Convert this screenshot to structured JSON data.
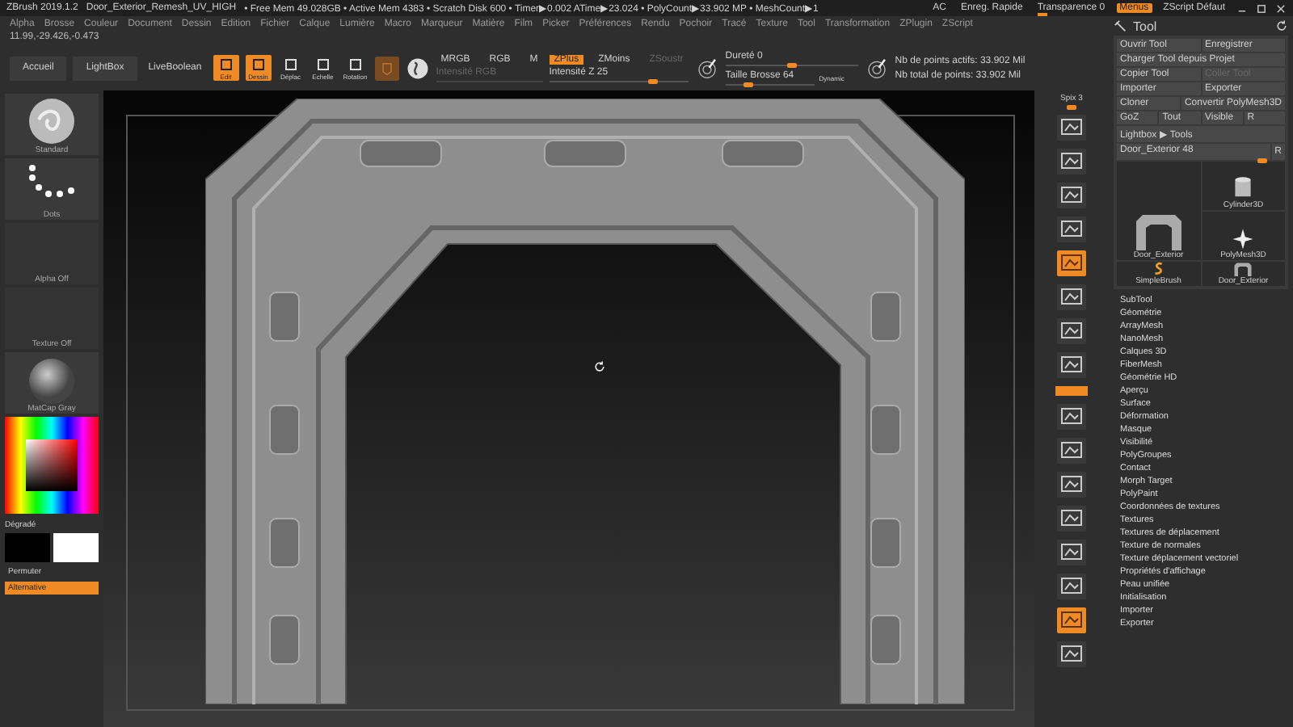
{
  "title_bar": {
    "app": "ZBrush 2019.1.2",
    "file": "Door_Exterior_Remesh_UV_HIGH",
    "stats": "• Free Mem 49.028GB • Active Mem 4383 • Scratch Disk 600 • Timer▶0.002 ATime▶23.024 • PolyCount▶33.902 MP • MeshCount▶1",
    "items": [
      {
        "label": "AC",
        "kind": "text"
      },
      {
        "label": "Enreg. Rapide",
        "kind": "text"
      },
      {
        "label": "Transparence 0",
        "kind": "slider",
        "level": 0.05
      },
      {
        "label": "Menus",
        "kind": "toggle",
        "selected": true
      },
      {
        "label": "ZScript Défaut",
        "kind": "text"
      }
    ]
  },
  "menu_bar": [
    "Alpha",
    "Brosse",
    "Couleur",
    "Document",
    "Dessin",
    "Edition",
    "Fichier",
    "Calque",
    "Lumière",
    "Macro",
    "Marqueur",
    "Matière",
    "Film",
    "Picker",
    "Préférences",
    "Rendu",
    "Pochoir",
    "Tracé",
    "Texture",
    "Tool",
    "Transformation",
    "ZPlugin",
    "ZScript"
  ],
  "coordinates": "11.99,-29.426,-0.473",
  "toolbar": {
    "nav_buttons": [
      "Accueil",
      "LightBox",
      "LiveBoolean"
    ],
    "modes": [
      {
        "label": "Edit",
        "selected": true
      },
      {
        "label": "Dessin",
        "selected": true
      },
      {
        "label": "Déplac",
        "selected": false
      },
      {
        "label": "Echelle",
        "selected": false
      },
      {
        "label": "Rotation",
        "selected": false
      }
    ],
    "rgb_modes": [
      {
        "label": "MRGB",
        "selected": false
      },
      {
        "label": "RGB",
        "selected": false
      },
      {
        "label": "M",
        "selected": false
      }
    ],
    "rgb_intensity": {
      "label": "Intensité RGB",
      "disabled": true
    },
    "z_modes": [
      {
        "label": "ZPlus",
        "selected": true,
        "disabled": false
      },
      {
        "label": "ZMoins",
        "selected": false,
        "disabled": false
      },
      {
        "label": "ZSoustr",
        "selected": false,
        "disabled": true
      }
    ],
    "z_intensity": {
      "label": "Intensité Z 25",
      "level": 0.75
    },
    "hardness": {
      "label": "Dureté 0",
      "level": 0.5
    },
    "brush_size": {
      "label": "Taille Brosse 64",
      "level": 0.25
    },
    "dynamic": "Dynamic",
    "active_points": "Nb de points actifs: 33.902 Mil",
    "total_points": "Nb total de points: 33.902 Mil"
  },
  "left_panel": {
    "brush": "Standard",
    "stroke": "Dots",
    "alpha": "Alpha Off",
    "texture": "Texture Off",
    "material": "MatCap Gray",
    "gradient": "Dégradé",
    "swap": "Permuter",
    "alternate": {
      "label": "Alternative",
      "selected": true
    }
  },
  "shelf": [
    {
      "kind": "slider",
      "label": "Spix 3",
      "level": 0.5
    },
    {
      "kind": "button",
      "selected": false
    },
    {
      "kind": "button",
      "selected": false
    },
    {
      "kind": "button",
      "selected": false
    },
    {
      "kind": "button",
      "selected": false
    },
    {
      "kind": "button",
      "selected": true
    },
    {
      "kind": "button",
      "selected": false
    },
    {
      "kind": "button",
      "selected": false
    },
    {
      "kind": "button",
      "selected": false
    },
    {
      "kind": "bar",
      "selected": true
    },
    {
      "kind": "button",
      "selected": false
    },
    {
      "kind": "button",
      "selected": false
    },
    {
      "kind": "button",
      "selected": false
    },
    {
      "kind": "button",
      "selected": false
    },
    {
      "kind": "button",
      "selected": false
    },
    {
      "kind": "button",
      "selected": false
    },
    {
      "kind": "button",
      "selected": true
    },
    {
      "kind": "button",
      "selected": false
    }
  ],
  "tool_panel": {
    "title": "Tool",
    "button_rows": [
      [
        {
          "label": "Ouvrir Tool",
          "disabled": false
        },
        {
          "label": "Enregistrer",
          "disabled": false
        }
      ],
      [
        {
          "label": "Charger Tool depuis Projet",
          "disabled": false
        }
      ],
      [
        {
          "label": "Copier Tool",
          "disabled": false
        },
        {
          "label": "Coller Tool",
          "disabled": true
        }
      ],
      [
        {
          "label": "Importer",
          "disabled": false
        },
        {
          "label": "Exporter",
          "disabled": false
        }
      ],
      [
        {
          "label": "Cloner",
          "disabled": false
        },
        {
          "label": "Convertir PolyMesh3D",
          "disabled": false
        }
      ],
      [
        {
          "label": "GoZ",
          "disabled": false
        },
        {
          "label": "Tout",
          "disabled": false
        },
        {
          "label": "Visible",
          "disabled": false
        },
        {
          "label": "R",
          "disabled": false
        }
      ],
      [
        {
          "label": "Lightbox ▶ Tools",
          "disabled": false
        }
      ]
    ],
    "tool_slider": {
      "label": "Door_Exterior 48",
      "level": 0.95,
      "reset": "R"
    },
    "tools": [
      {
        "label": "Cylinder3D",
        "kind": "cylinder"
      },
      {
        "label": "Door_Exterior",
        "kind": "arch"
      },
      {
        "label": "PolyMesh3D",
        "kind": "star"
      },
      {
        "label": "SimpleBrush",
        "kind": "brush"
      },
      {
        "label": "Door_Exterior",
        "kind": "arch"
      }
    ],
    "sections": [
      "SubTool",
      "Géométrie",
      "ArrayMesh",
      "NanoMesh",
      "Calques 3D",
      "FiberMesh",
      "Géométrie HD",
      "Aperçu",
      "Surface",
      "Déformation",
      "Masque",
      "Visibilité",
      "PolyGroupes",
      "Contact",
      "Morph Target",
      "PolyPaint",
      "Coordonnées de textures",
      "Textures",
      "Textures de déplacement",
      "Texture de normales",
      "Texture déplacement vectoriel",
      "Propriétés d'affichage",
      "Peau unifiée",
      "Initialisation",
      "Importer",
      "Exporter"
    ]
  }
}
